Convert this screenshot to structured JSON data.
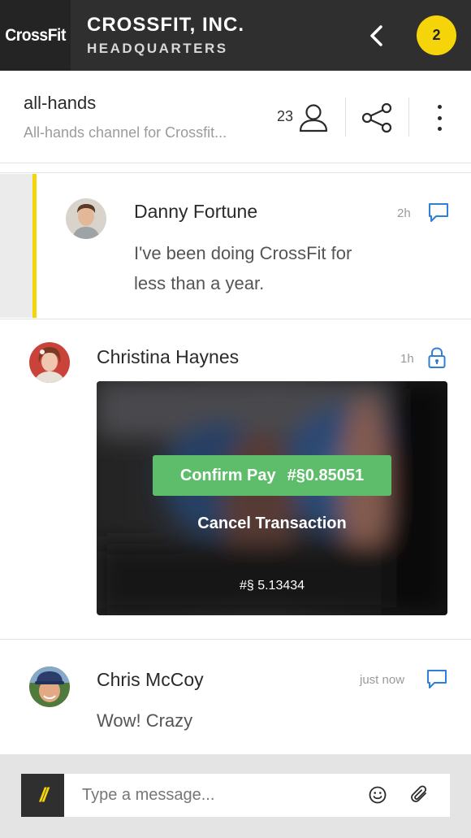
{
  "header": {
    "logo": "CrossFit",
    "org_name": "CROSSFIT, INC.",
    "org_sub": "HEADQUARTERS",
    "notification_count": "2",
    "accent_color": "#f5d50a"
  },
  "channel": {
    "name": "all-hands",
    "description": "All-hands channel for Crossfit...",
    "member_count": "23"
  },
  "messages": [
    {
      "author": "Danny Fortune",
      "time": "2h",
      "text_line1": "I've been doing CrossFit for",
      "text_line2": "less than a year.",
      "action_icon": "reply-icon"
    },
    {
      "author": "Christina Haynes",
      "time": "1h",
      "action_icon": "lock-icon",
      "payment": {
        "confirm_label": "Confirm Pay",
        "confirm_amount": "#§0.85051",
        "cancel_label": "Cancel Transaction",
        "balance": "#§ 5.13434"
      }
    },
    {
      "author": "Chris McCoy",
      "time": "just now",
      "text": "Wow! Crazy",
      "action_icon": "reply-icon"
    }
  ],
  "composer": {
    "placeholder": "Type a message...",
    "logo_glyph": "//"
  }
}
